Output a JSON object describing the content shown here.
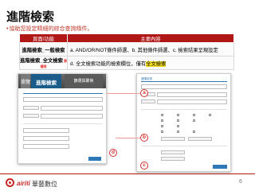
{
  "title": "進階檢索",
  "subtitle": "協助您設定精細的綜合查詢條件。",
  "table": {
    "headers": [
      "頁面/功能",
      "主要內容"
    ],
    "rows": [
      {
        "name": "進階檢索_一般檢索",
        "content": "a. AND/OR/NOT條件師選、b. 其他條件師選、c. 檢索結果呈現設定"
      },
      {
        "name": "進階檢索_全文檢索",
        "note": "需權限",
        "content_prefix": "d. 全文檢索功能的檢索欄位，僅有",
        "content_highlight": "全文檢索"
      }
    ]
  },
  "left_screenshot": {
    "tabs": [
      "瀏覽",
      "進階檢索",
      "篩選與聚焦"
    ]
  },
  "right_screenshot": {
    "header": "進階檢索"
  },
  "markers": [
    "a",
    "b",
    "c",
    "d"
  ],
  "footer": {
    "logo_text": "airiti",
    "company": "華藝數位",
    "page_number": "6"
  },
  "colors": {
    "accent": "#b01818",
    "tab_active": "#1a5c8a",
    "highlight": "#f5e020",
    "marker": "#d32f2f"
  }
}
